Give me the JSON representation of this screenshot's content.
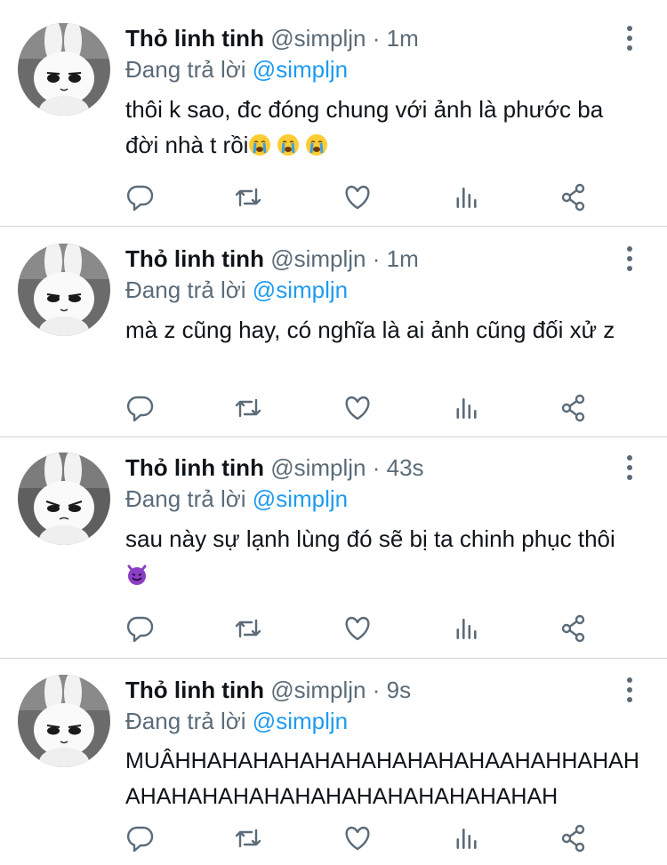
{
  "tweets": [
    {
      "name": "Thỏ linh tinh",
      "handle": "@simpljn",
      "dot": "·",
      "time": "1m",
      "reply_prefix": "Đang trả lời",
      "reply_to": "@simpljn",
      "text": "thôi k sao, đc đóng chung với ảnh là phước ba đời nhà t rồi",
      "emojis": [
        "loudly-crying-face",
        "loudly-crying-face",
        "loudly-crying-face"
      ]
    },
    {
      "name": "Thỏ linh tinh",
      "handle": "@simpljn",
      "dot": "·",
      "time": "1m",
      "reply_prefix": "Đang trả lời",
      "reply_to": "@simpljn",
      "text": "mà z cũng hay, có nghĩa là ai ảnh cũng đối xử z",
      "emojis": []
    },
    {
      "name": "Thỏ linh tinh",
      "handle": "@simpljn",
      "dot": "·",
      "time": "43s",
      "reply_prefix": "Đang trả lời",
      "reply_to": "@simpljn",
      "text": "sau này sự lạnh lùng đó sẽ bị ta chinh phục thôi",
      "emojis": [
        "smiling-devil-face"
      ]
    },
    {
      "name": "Thỏ linh tinh",
      "handle": "@simpljn",
      "dot": "·",
      "time": "9s",
      "reply_prefix": "Đang trả lời",
      "reply_to": "@simpljn",
      "text": "MUÂHHAHAHAHAHAHAHAHAHAHAAHAHHAHAHAHAHAHAHAHAHAHAHAHAHAHAHAHAH",
      "emojis": []
    }
  ],
  "actions": [
    "reply-icon",
    "retweet-icon",
    "like-icon",
    "analytics-icon",
    "share-icon"
  ],
  "colors": {
    "text": "#0f1419",
    "secondary": "#5b6b78",
    "link": "#1d9bf0",
    "divider": "#cfd6dc"
  }
}
